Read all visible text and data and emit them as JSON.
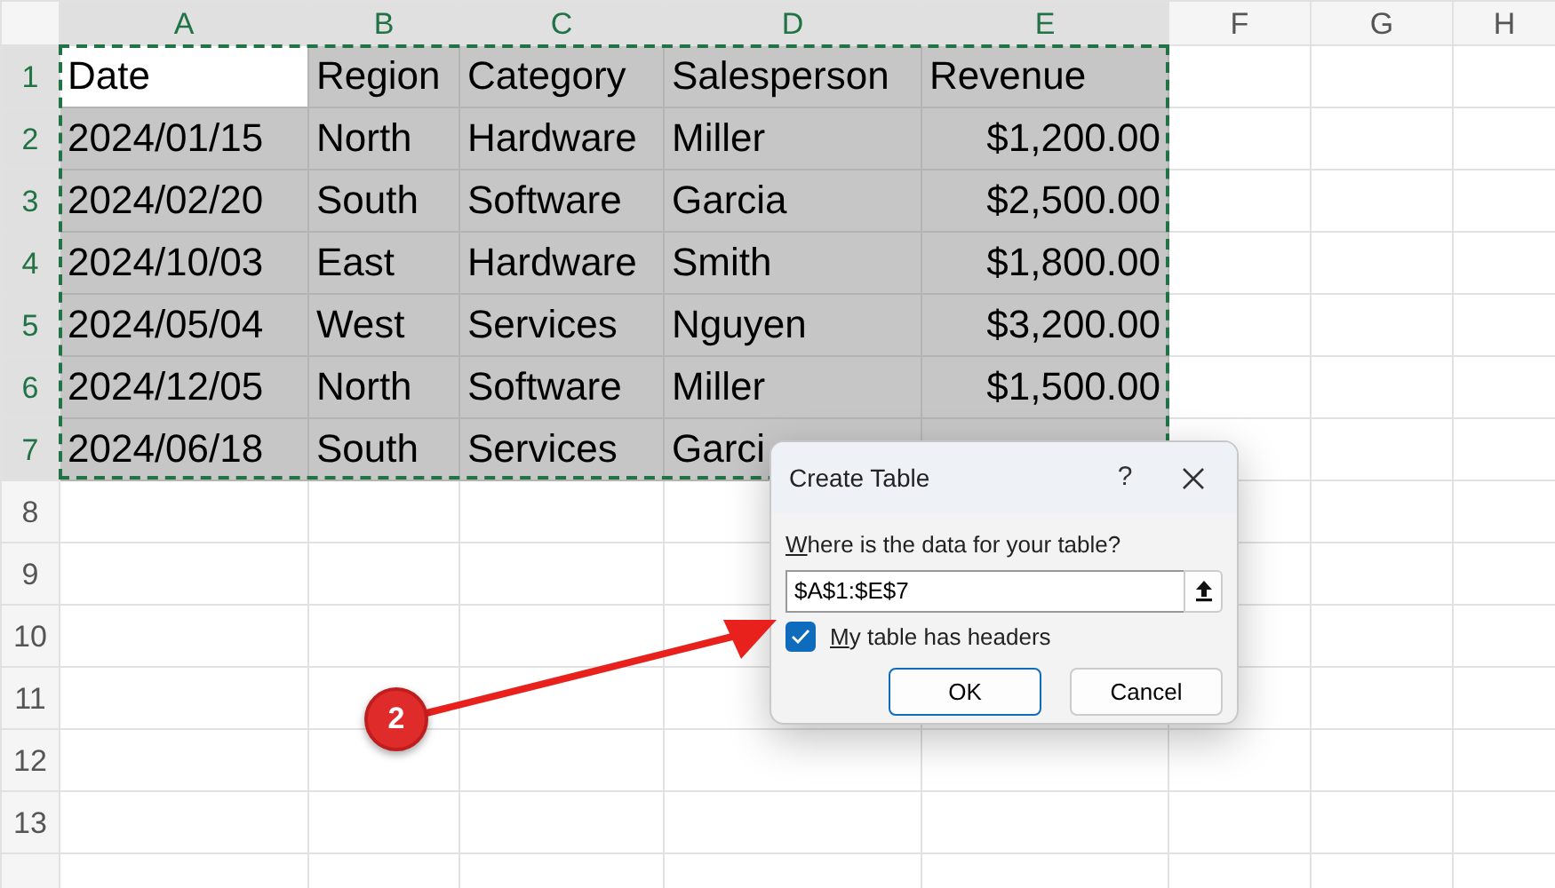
{
  "sheet": {
    "copy_marquee": true,
    "columns": [
      {
        "label": "A",
        "selected": true
      },
      {
        "label": "B",
        "selected": true
      },
      {
        "label": "C",
        "selected": true
      },
      {
        "label": "D",
        "selected": true
      },
      {
        "label": "E",
        "selected": true
      },
      {
        "label": "F",
        "selected": false
      },
      {
        "label": "G",
        "selected": false
      },
      {
        "label": "H",
        "selected": false
      }
    ],
    "rows": [
      {
        "number": "1",
        "selected": true,
        "cells": [
          {
            "text": "Date",
            "kind": "text",
            "active": true
          },
          {
            "text": "Region",
            "kind": "text",
            "active": false
          },
          {
            "text": "Category",
            "kind": "text",
            "active": false
          },
          {
            "text": "Salesperson",
            "kind": "text",
            "active": false
          },
          {
            "text": "Revenue",
            "kind": "text",
            "active": false
          }
        ]
      },
      {
        "number": "2",
        "selected": true,
        "cells": [
          {
            "text": "2024/01/15",
            "kind": "text",
            "active": false
          },
          {
            "text": "North",
            "kind": "text",
            "active": false
          },
          {
            "text": "Hardware",
            "kind": "text",
            "active": false
          },
          {
            "text": "Miller",
            "kind": "text",
            "active": false
          },
          {
            "text": "$1,200.00",
            "kind": "currency",
            "active": false
          }
        ]
      },
      {
        "number": "3",
        "selected": true,
        "cells": [
          {
            "text": "2024/02/20",
            "kind": "text",
            "active": false
          },
          {
            "text": "South",
            "kind": "text",
            "active": false
          },
          {
            "text": "Software",
            "kind": "text",
            "active": false
          },
          {
            "text": "Garcia",
            "kind": "text",
            "active": false
          },
          {
            "text": "$2,500.00",
            "kind": "currency",
            "active": false
          }
        ]
      },
      {
        "number": "4",
        "selected": true,
        "cells": [
          {
            "text": "2024/10/03",
            "kind": "text",
            "active": false
          },
          {
            "text": "East",
            "kind": "text",
            "active": false
          },
          {
            "text": "Hardware",
            "kind": "text",
            "active": false
          },
          {
            "text": "Smith",
            "kind": "text",
            "active": false
          },
          {
            "text": "$1,800.00",
            "kind": "currency",
            "active": false
          }
        ]
      },
      {
        "number": "5",
        "selected": true,
        "cells": [
          {
            "text": "2024/05/04",
            "kind": "text",
            "active": false
          },
          {
            "text": "West",
            "kind": "text",
            "active": false
          },
          {
            "text": "Services",
            "kind": "text",
            "active": false
          },
          {
            "text": "Nguyen",
            "kind": "text",
            "active": false
          },
          {
            "text": "$3,200.00",
            "kind": "currency",
            "active": false
          }
        ]
      },
      {
        "number": "6",
        "selected": true,
        "cells": [
          {
            "text": "2024/12/05",
            "kind": "text",
            "active": false
          },
          {
            "text": "North",
            "kind": "text",
            "active": false
          },
          {
            "text": "Software",
            "kind": "text",
            "active": false
          },
          {
            "text": "Miller",
            "kind": "text",
            "active": false
          },
          {
            "text": "$1,500.00",
            "kind": "currency",
            "active": false
          }
        ]
      },
      {
        "number": "7",
        "selected": true,
        "cells": [
          {
            "text": "2024/06/18",
            "kind": "text",
            "active": false
          },
          {
            "text": "South",
            "kind": "text",
            "active": false
          },
          {
            "text": "Services",
            "kind": "text",
            "active": false
          },
          {
            "text": "Garci",
            "kind": "text",
            "active": false
          }
        ]
      },
      {
        "number": "8",
        "selected": false,
        "cells": []
      },
      {
        "number": "9",
        "selected": false,
        "cells": []
      },
      {
        "number": "10",
        "selected": false,
        "cells": []
      },
      {
        "number": "11",
        "selected": false,
        "cells": []
      },
      {
        "number": "12",
        "selected": false,
        "cells": []
      },
      {
        "number": "13",
        "selected": false,
        "cells": []
      }
    ]
  },
  "dialog": {
    "title": "Create Table",
    "help": "?",
    "prompt": "Where is the data for your table?",
    "range": "$A$1:$E$7",
    "headers_checkbox": {
      "label": "My table has headers",
      "checked": true
    },
    "buttons": [
      {
        "label": "OK",
        "default": true
      },
      {
        "label": "Cancel",
        "default": false
      }
    ]
  },
  "callout": {
    "number": "2"
  }
}
